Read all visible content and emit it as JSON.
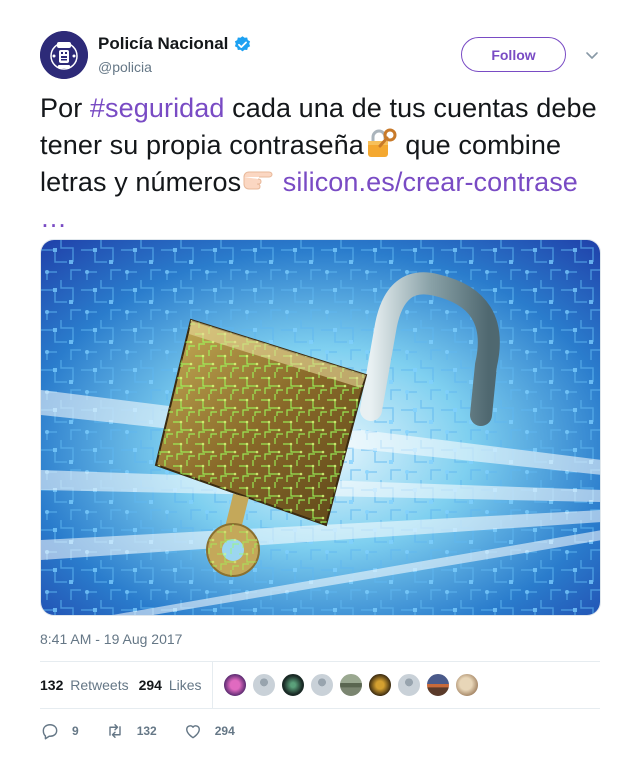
{
  "user": {
    "display_name": "Policía Nacional",
    "handle": "@policia",
    "verified": true,
    "brand_color": "#2d2a78"
  },
  "actions": {
    "follow_label": "Follow",
    "menu_icon": "chevron-down-icon"
  },
  "tweet": {
    "text_parts": [
      {
        "type": "text",
        "value": "Por "
      },
      {
        "type": "hashtag",
        "value": "#seguridad"
      },
      {
        "type": "text",
        "value": " cada una de tus cuentas debe tener su propia contraseña"
      },
      {
        "type": "emoji",
        "value": "lock-with-key-icon"
      },
      {
        "type": "text",
        "value": " que combine letras y números"
      },
      {
        "type": "emoji",
        "value": "pointing-right-icon"
      },
      {
        "type": "text",
        "value": " "
      },
      {
        "type": "link",
        "value": "silicon.es/crear-contrase …"
      }
    ],
    "link_color": "#794bc4",
    "media_alt": "open-padlock-circuit-image",
    "timestamp": "8:41 AM - 19 Aug 2017"
  },
  "stats": {
    "retweets_count": "132",
    "retweets_label": "Retweets",
    "likes_count": "294",
    "likes_label": "Likes",
    "liker_colors": [
      "#8e3a8a",
      "#c9d1d8",
      "#1a2a26",
      "#c9d1d8",
      "#7a8570",
      "#4a3a1a",
      "#c9d1d8",
      "#6b4a3a",
      "#c8b49a"
    ]
  },
  "footer": {
    "reply_count": "9",
    "retweet_count": "132",
    "like_count": "294"
  }
}
